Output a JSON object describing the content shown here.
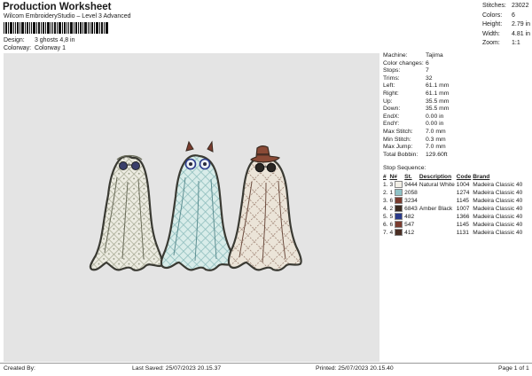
{
  "header": {
    "title": "Production Worksheet",
    "subtitle": "Wilcom EmbroideryStudio – Level 3 Advanced",
    "design_label": "Design:",
    "design_value": "3 ghosts 4,8 in",
    "colorway_label": "Colorway:",
    "colorway_value": "Colorway 1"
  },
  "stats": [
    {
      "label": "Stitches:",
      "value": "23022"
    },
    {
      "label": "Colors:",
      "value": "6"
    },
    {
      "label": "Height:",
      "value": "2.79 in"
    },
    {
      "label": "Width:",
      "value": "4.81 in"
    },
    {
      "label": "Zoom:",
      "value": "1:1"
    }
  ],
  "machine_info": [
    {
      "label": "Machine:",
      "value": "Tajima"
    },
    {
      "label": "Color changes:",
      "value": "6"
    },
    {
      "label": "Stops:",
      "value": "7"
    },
    {
      "label": "Trims:",
      "value": "32"
    },
    {
      "label": "Left:",
      "value": "61.1 mm"
    },
    {
      "label": "Right:",
      "value": "61.1 mm"
    },
    {
      "label": "Up:",
      "value": "35.5 mm"
    },
    {
      "label": "Down:",
      "value": "35.5 mm"
    },
    {
      "label": "EndX:",
      "value": "0.00 in"
    },
    {
      "label": "EndY:",
      "value": "0.00 in"
    },
    {
      "label": "Max Stitch:",
      "value": "7.0 mm"
    },
    {
      "label": "Min Stitch:",
      "value": "0.3 mm"
    },
    {
      "label": "Max Jump:",
      "value": "7.0 mm"
    },
    {
      "label": "Total Bobbin:",
      "value": "129.60ft"
    }
  ],
  "stop_sequence": {
    "heading": "Stop Sequence:",
    "columns": [
      "#",
      "N#",
      "St.",
      "Description",
      "Code",
      "Brand"
    ],
    "rows": [
      {
        "num": "1.",
        "n": "3",
        "color": "#f2efe6",
        "st": "9444",
        "desc": "Natural White",
        "code": "1004",
        "brand": "Madeira Classic 40"
      },
      {
        "num": "2.",
        "n": "1",
        "color": "#8ec2c6",
        "st": "2058",
        "desc": "",
        "code": "1274",
        "brand": "Madeira Classic 40"
      },
      {
        "num": "3.",
        "n": "6",
        "color": "#7a3b2e",
        "st": "3234",
        "desc": "",
        "code": "1145",
        "brand": "Madeira Classic 40"
      },
      {
        "num": "4.",
        "n": "2",
        "color": "#3a2a20",
        "st": "6843",
        "desc": "Amber Black",
        "code": "1007",
        "brand": "Madeira Classic 40"
      },
      {
        "num": "5.",
        "n": "5",
        "color": "#2a3a8a",
        "st": "482",
        "desc": "",
        "code": "1366",
        "brand": "Madeira Classic 40"
      },
      {
        "num": "6.",
        "n": "6",
        "color": "#7a3b2e",
        "st": "547",
        "desc": "",
        "code": "1145",
        "brand": "Madeira Classic 40"
      },
      {
        "num": "7.",
        "n": "4",
        "color": "#4a2e24",
        "st": "412",
        "desc": "",
        "code": "1131",
        "brand": "Madeira Classic 40"
      }
    ]
  },
  "footer": {
    "created_by": "Created By:",
    "last_saved": "Last Saved: 25/07/2023 20.15.37",
    "printed": "Printed: 25/07/2023 20.15.40",
    "page": "Page 1 of 1"
  }
}
